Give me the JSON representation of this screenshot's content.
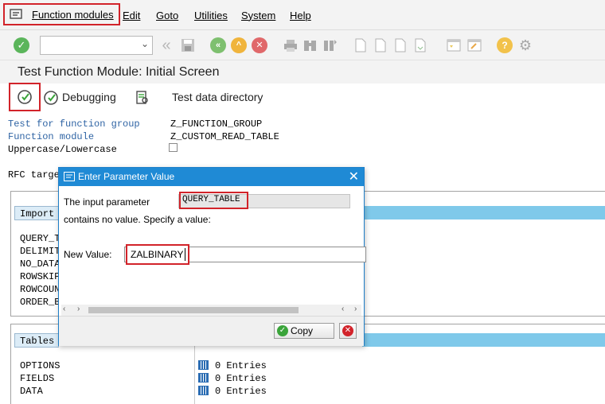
{
  "menu": {
    "items": [
      "Function modules",
      "Edit",
      "Goto",
      "Utilities",
      "System",
      "Help"
    ]
  },
  "toolbar": {
    "command_field_value": "",
    "icons": [
      "enter-icon",
      "back-icon",
      "save-icon",
      "back-nav-icon",
      "exit-icon",
      "cancel-icon",
      "print-icon",
      "find-icon",
      "find-next-icon",
      "first-page-icon",
      "prev-page-icon",
      "next-page-icon",
      "last-page-icon",
      "create-session-icon",
      "shortcut-icon",
      "help-icon",
      "settings-icon"
    ]
  },
  "title": "Test Function Module: Initial Screen",
  "app_toolbar": {
    "debugging": "Debugging",
    "test_data_directory": "Test data directory"
  },
  "fields": {
    "group_label": "Test for function group",
    "group_value": "Z_FUNCTION_GROUP",
    "module_label": "Function module",
    "module_value": "Z_CUSTOM_READ_TABLE",
    "case_label": "Uppercase/Lowercase",
    "rfc_label": "RFC targe"
  },
  "import": {
    "header": "Import",
    "params": [
      "QUERY_T",
      "DELIMIT",
      "NO_DATA",
      "ROWSKIP",
      "ROWCOUN",
      "ORDER_B"
    ]
  },
  "tables": {
    "header": "Tables",
    "rows": [
      {
        "name": "OPTIONS",
        "entries": "0 Entries"
      },
      {
        "name": "FIELDS",
        "entries": "0 Entries"
      },
      {
        "name": "DATA",
        "entries": "0 Entries"
      }
    ]
  },
  "dialog": {
    "title": "Enter Parameter Value",
    "input_param_label": "The input parameter",
    "param_name": "QUERY_TABLE",
    "message": "contains no value. Specify a value:",
    "new_value_label": "New Value:",
    "new_value": "ZALBINARY",
    "copy_label": "Copy"
  },
  "colors": {
    "highlight_red": "#d2232a",
    "dialog_blue": "#1f8ad5",
    "label_blue": "#2f64a4"
  }
}
